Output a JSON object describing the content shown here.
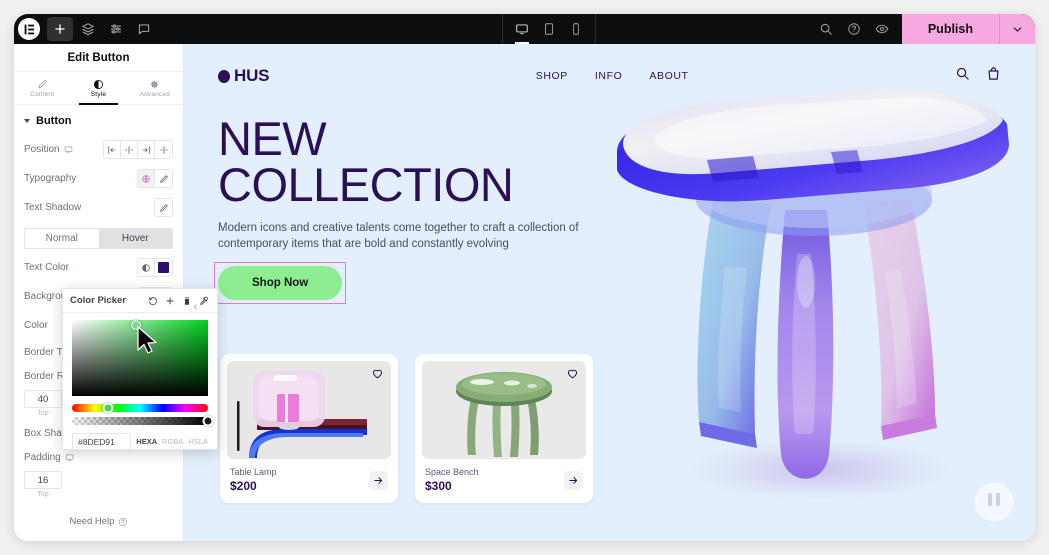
{
  "topbar": {
    "logo_icon": "elementor-logo-icon",
    "buttons": [
      {
        "name": "add-element-button",
        "icon": "plus-icon",
        "active": true
      },
      {
        "name": "navigator-button",
        "icon": "layers-icon",
        "active": false
      },
      {
        "name": "site-settings-button",
        "icon": "sliders-icon",
        "active": false
      },
      {
        "name": "comments-button",
        "icon": "comment-icon",
        "active": false
      }
    ],
    "devices": [
      {
        "name": "device-desktop",
        "icon": "desktop-icon",
        "selected": true
      },
      {
        "name": "device-tablet",
        "icon": "tablet-icon",
        "selected": false
      },
      {
        "name": "device-mobile",
        "icon": "mobile-icon",
        "selected": false
      }
    ],
    "right_icons": [
      {
        "name": "search-icon",
        "icon": "search-icon"
      },
      {
        "name": "help-icon",
        "icon": "question-circle-icon"
      },
      {
        "name": "preview-icon",
        "icon": "eye-icon"
      }
    ],
    "publish_label": "Publish",
    "publish_color": "#f6a8e0",
    "publish_more_icon": "chevron-down-icon"
  },
  "panel": {
    "title": "Edit Button",
    "tabs": [
      {
        "label": "Content",
        "icon": "pencil-icon",
        "active": false
      },
      {
        "label": "Style",
        "icon": "contrast-icon",
        "active": true
      },
      {
        "label": "Advanced",
        "icon": "gear-icon",
        "active": false
      }
    ],
    "section": {
      "label": "Button",
      "expanded": true
    },
    "rows": [
      {
        "label": "Position",
        "has_device_icon": true,
        "controls": "align-group"
      },
      {
        "label": "Typography",
        "has_device_icon": false,
        "controls": "typography-group"
      },
      {
        "label": "Text Shadow",
        "has_device_icon": false,
        "controls": "shadow-edit"
      }
    ],
    "state_tabs": [
      {
        "label": "Normal",
        "selected": false
      },
      {
        "label": "Hover",
        "selected": true
      }
    ],
    "style_rows": [
      {
        "label": "Text Color",
        "swatch": "#2d0f6e"
      },
      {
        "label": "Background Type",
        "controls": "bg-type-group"
      },
      {
        "label": "Color",
        "swatch": "#8ded91"
      }
    ],
    "lower_rows": [
      {
        "label": "Border Type"
      },
      {
        "label": "Border Radius"
      }
    ],
    "border_radius": {
      "value": "40",
      "unit_label": "Top"
    },
    "box_shadow_label": "Box Shadow",
    "padding": {
      "label": "Padding",
      "value": "16",
      "unit_label": "Top",
      "has_device_icon": true
    },
    "need_help": {
      "label": "Need Help",
      "icon": "question-circle-icon"
    }
  },
  "color_picker": {
    "title": "Color Picker",
    "tools": [
      {
        "name": "reset-color-button",
        "icon": "undo-icon"
      },
      {
        "name": "add-color-button",
        "icon": "plus-icon"
      },
      {
        "name": "delete-color-button",
        "icon": "trash-icon"
      },
      {
        "name": "eyedropper-button",
        "icon": "eyedropper-icon"
      }
    ],
    "hex_value": "#8DED91",
    "modes": [
      {
        "label": "HEXA",
        "selected": true
      },
      {
        "label": "RGBA",
        "selected": false
      },
      {
        "label": "HSLA",
        "selected": false
      }
    ],
    "collapse_icon": "chevron-left-icon"
  },
  "site": {
    "logo": {
      "text": "HUS",
      "icon": "dot-icon"
    },
    "nav": [
      {
        "label": "SHOP"
      },
      {
        "label": "INFO"
      },
      {
        "label": "ABOUT"
      }
    ],
    "header_icons": [
      {
        "name": "search-icon",
        "icon": "search-icon"
      },
      {
        "name": "cart-icon",
        "icon": "bag-icon"
      }
    ],
    "hero": {
      "title_line1": "NEW",
      "title_line2": "COLLECTION",
      "subtitle": "Modern icons and creative talents come together to craft a collection of contemporary items that are bold and constantly evolving",
      "cta_label": "Shop Now",
      "cta_bg": "#8ded91",
      "selection_color": "#e879c8"
    },
    "products": [
      {
        "name": "Table Lamp",
        "price": "$200",
        "fav_icon": "heart-icon",
        "arrow_icon": "arrow-right-icon"
      },
      {
        "name": "Space Bench",
        "price": "$300",
        "fav_icon": "heart-icon",
        "arrow_icon": "arrow-right-icon"
      }
    ],
    "pause_button": {
      "icon": "pause-icon"
    },
    "background_color": "#e3effc"
  }
}
